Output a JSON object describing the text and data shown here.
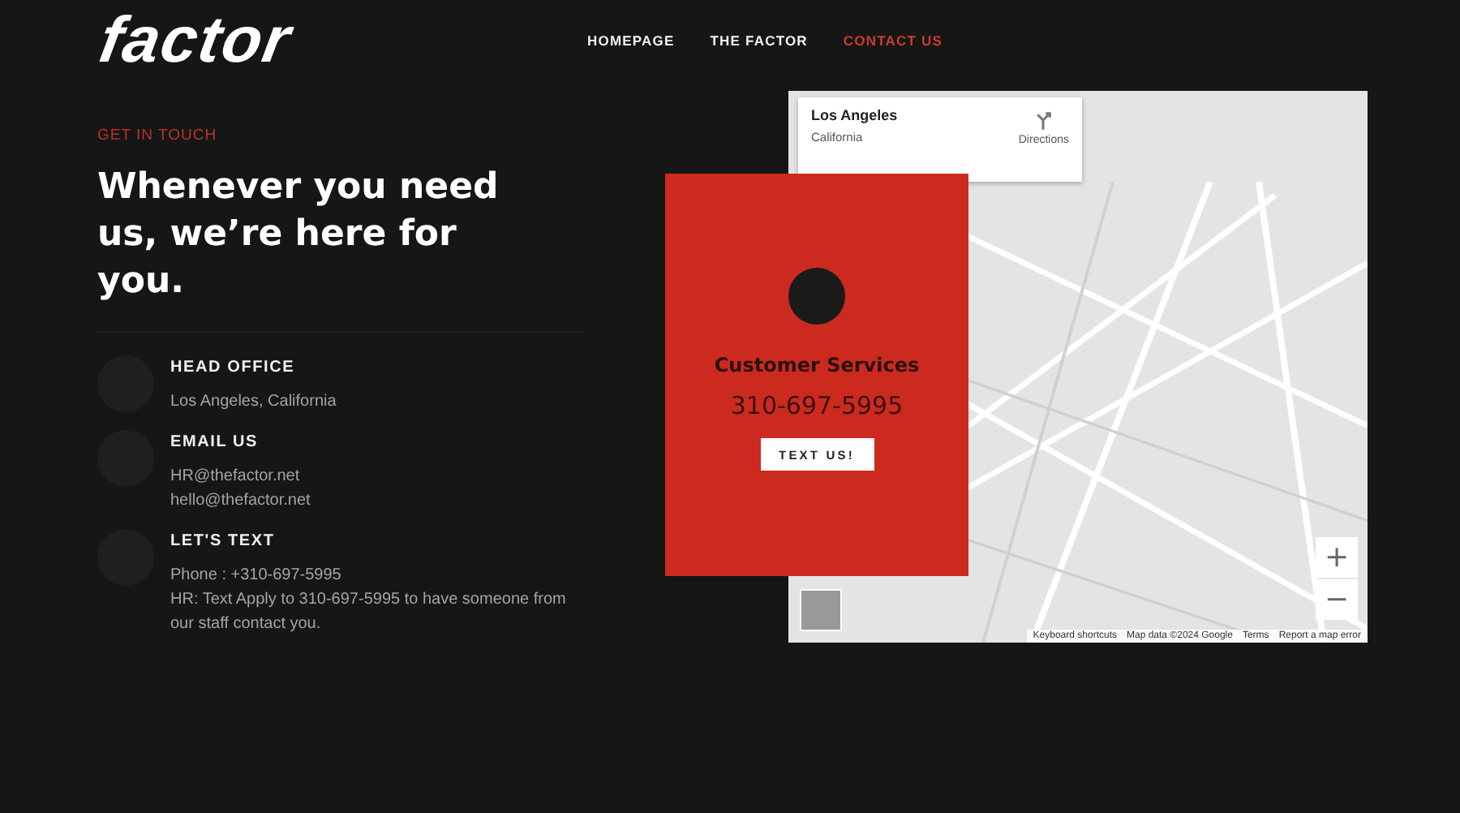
{
  "header": {
    "logo": "factor",
    "nav": [
      {
        "label": "HOMEPAGE",
        "selected": false
      },
      {
        "label": "THE FACTOR",
        "selected": false
      },
      {
        "label": "CONTACT US",
        "selected": true
      }
    ]
  },
  "contact": {
    "eyebrow": "GET IN TOUCH",
    "heading": "Whenever you need us, we’re here for you.",
    "items": [
      {
        "title": "HEAD OFFICE",
        "lines": [
          "Los Angeles, California"
        ]
      },
      {
        "title": "EMAIL US",
        "lines": [
          "HR@thefactor.net",
          "hello@thefactor.net"
        ]
      },
      {
        "title": "LET'S TEXT",
        "lines": [
          "Phone : +310-697-5995",
          "HR: Text Apply to 310-697-5995 to have someone from our staff contact you."
        ]
      }
    ]
  },
  "service_card": {
    "title": "Customer Services",
    "phone": "310-697-5995",
    "button": "TEXT US!"
  },
  "map": {
    "place": "Los Angeles",
    "region": "California",
    "directions": "Directions",
    "zoom_in": "+",
    "zoom_out": "−",
    "footer": [
      "Keyboard shortcuts",
      "Map data ©2024 Google",
      "Terms",
      "Report a map error"
    ]
  }
}
